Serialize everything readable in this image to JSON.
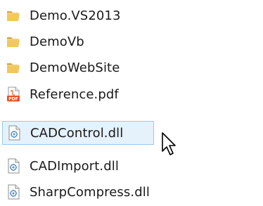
{
  "files": [
    {
      "name": "Demo.VS2013",
      "icon": "folder-icon"
    },
    {
      "name": "DemoVb",
      "icon": "folder-icon"
    },
    {
      "name": "DemoWebSite",
      "icon": "folder-icon"
    },
    {
      "name": "Reference.pdf",
      "icon": "pdf-file-icon",
      "badge": "PDF"
    },
    {
      "name": "CADControl.dll",
      "icon": "dll-file-icon",
      "selected": true
    },
    {
      "name": "CADImport.dll",
      "icon": "dll-file-icon"
    },
    {
      "name": "SharpCompress.dll",
      "icon": "dll-file-icon"
    }
  ],
  "colors": {
    "selection_background": "#e5f1fb",
    "selection_border": "#99c9ef",
    "folder": "#e8b84a",
    "pdf_accent": "#e0522b"
  },
  "cursor": {
    "icon": "mouse-pointer-icon",
    "hovering": "CADControl.dll"
  }
}
